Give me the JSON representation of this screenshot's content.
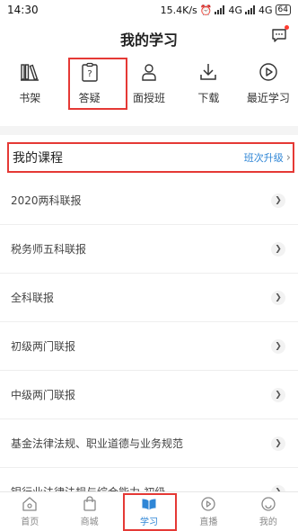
{
  "status": {
    "time": "14:30",
    "indicators": "15.4K/s",
    "net1": "4G",
    "net2": "4G",
    "battery": "64"
  },
  "header": {
    "title": "我的学习"
  },
  "quick": [
    {
      "label": "书架",
      "icon": "bookshelf-icon"
    },
    {
      "label": "答疑",
      "icon": "question-board-icon"
    },
    {
      "label": "面授班",
      "icon": "teacher-icon"
    },
    {
      "label": "下载",
      "icon": "download-icon"
    },
    {
      "label": "最近学习",
      "icon": "play-circle-icon"
    }
  ],
  "courses": {
    "title": "我的课程",
    "upgrade": "班次升级",
    "items": [
      "2020两科联报",
      "税务师五科联报",
      "全科联报",
      "初级两门联报",
      "中级两门联报",
      "基金法律法规、职业道德与业务规范",
      "银行业法律法规与综合能力-初级"
    ]
  },
  "tabs": [
    {
      "label": "首页",
      "icon": "home-icon"
    },
    {
      "label": "商城",
      "icon": "shop-bag-icon"
    },
    {
      "label": "学习",
      "icon": "book-icon",
      "active": true
    },
    {
      "label": "直播",
      "icon": "live-play-icon"
    },
    {
      "label": "我的",
      "icon": "smile-icon"
    }
  ],
  "colors": {
    "accent": "#2f86d6",
    "highlight": "#e53935"
  }
}
